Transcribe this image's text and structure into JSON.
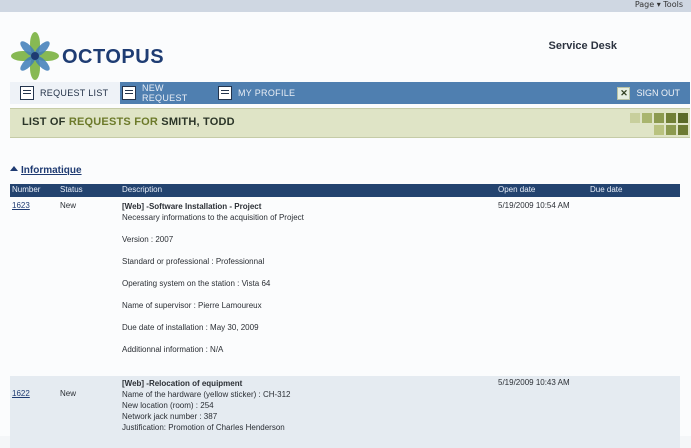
{
  "browser": {
    "tools_label": "Page ▾  Tools"
  },
  "header": {
    "brand": "OCTOPUS",
    "service_desk": "Service Desk"
  },
  "tabs": [
    {
      "label": "REQUEST LIST",
      "icon": "list-icon"
    },
    {
      "label": "NEW REQUEST",
      "icon": "document-icon"
    },
    {
      "label": "MY PROFILE",
      "icon": "profile-icon"
    }
  ],
  "sign_out": "SIGN OUT",
  "banner": {
    "prefix": "LIST OF ",
    "accent": "REQUESTS FOR ",
    "name": "SMITH, TODD"
  },
  "section": {
    "title": "Informatique"
  },
  "table": {
    "columns": [
      "Number",
      "Status",
      "Description",
      "Open date",
      "Due date"
    ],
    "rows": [
      {
        "number": "1623",
        "status": "New",
        "title": "[Web] -Software Installation - Project",
        "lines": [
          "Necessary informations to the acquisition of Project",
          "",
          "Version : 2007",
          "",
          "Standard or professional : Professionnal",
          "",
          "Operating system on the station : Vista 64",
          "",
          "Name of supervisor : Pierre Lamoureux",
          "",
          "Due date of installation : May 30, 2009",
          "",
          "Additionnal information : N/A"
        ],
        "open_date": "5/19/2009 10:54 AM",
        "due_date": ""
      },
      {
        "number": "1622",
        "status": "New",
        "title": "[Web] -Relocation of equipment",
        "lines": [
          "Name of the hardware (yellow sticker) : CH-312",
          "New location (room) : 254",
          "Network jack number : 387",
          "Justification: Promotion of Charles Henderson"
        ],
        "open_date": "5/19/2009 10:43 AM",
        "due_date": ""
      }
    ]
  }
}
